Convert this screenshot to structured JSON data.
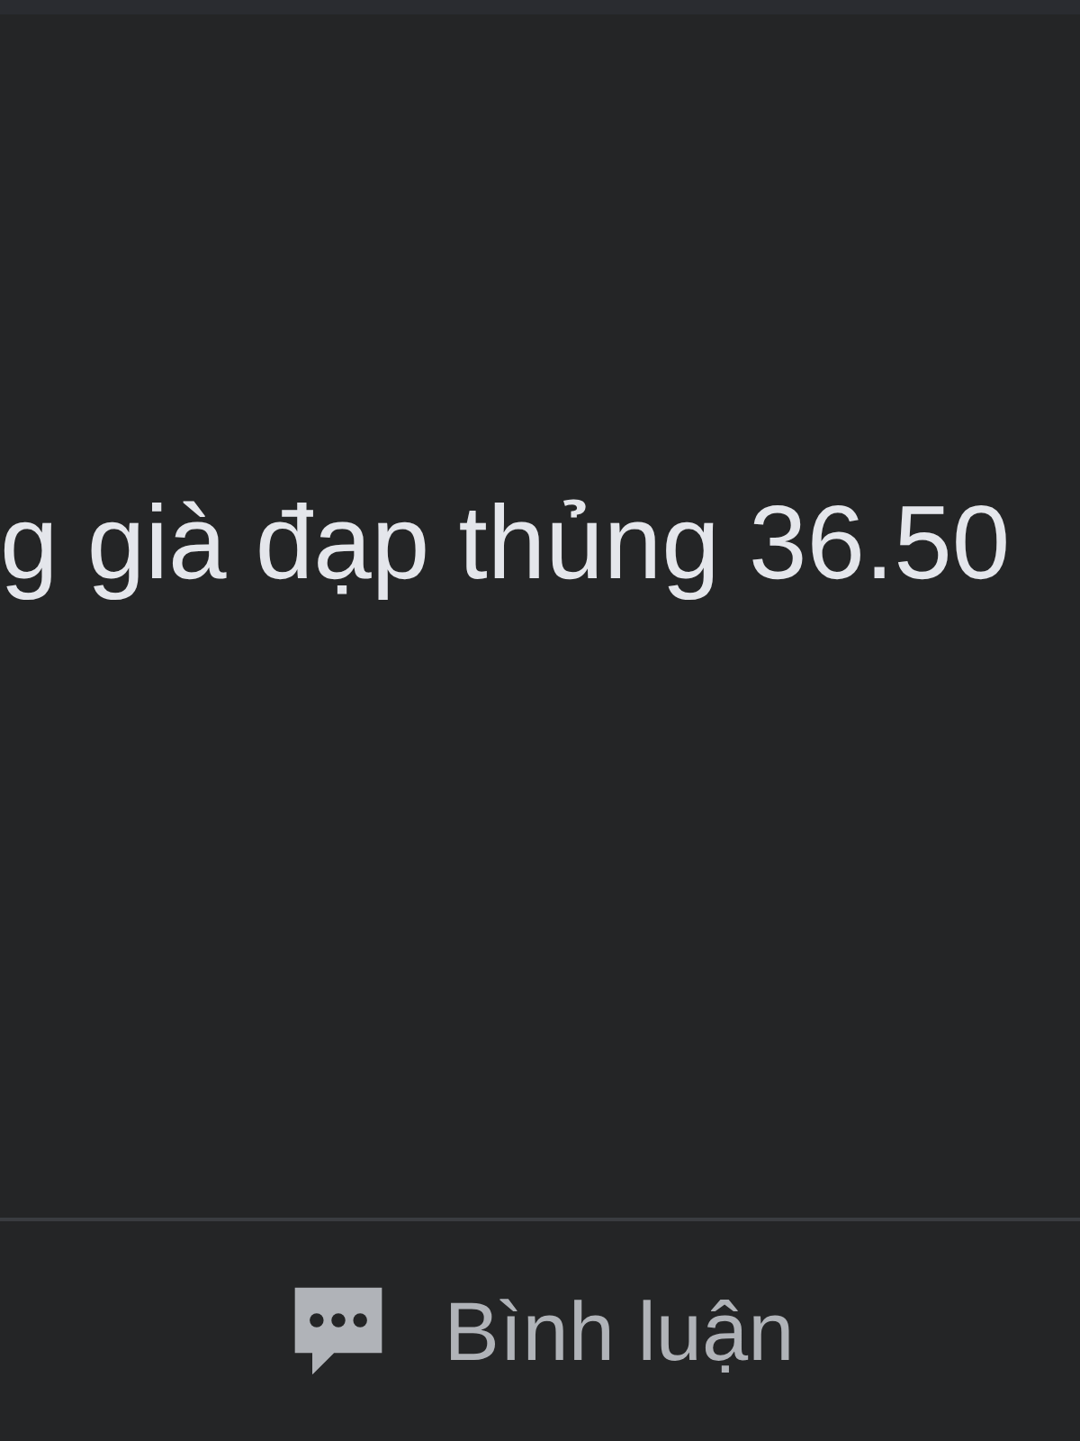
{
  "post_text": "g già đạp thủng 36.50",
  "actions": [
    {
      "label": "Bình luận",
      "kind": "comment"
    }
  ]
}
